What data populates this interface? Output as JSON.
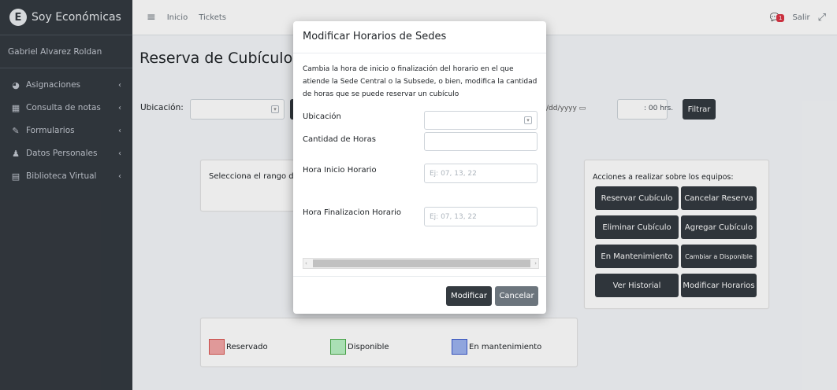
{
  "brand": {
    "name": "Soy Económicas",
    "logo_letter": "E"
  },
  "user": {
    "name": "Gabriel Alvarez Roldan"
  },
  "sidebar": {
    "items": [
      {
        "label": "Asignaciones",
        "icon": "dashboard-icon",
        "glyph": "◕"
      },
      {
        "label": "Consulta de notas",
        "icon": "table-icon",
        "glyph": "▦"
      },
      {
        "label": "Formularios",
        "icon": "edit-icon",
        "glyph": "✎"
      },
      {
        "label": "Datos Personales",
        "icon": "user-icon",
        "glyph": "♟"
      },
      {
        "label": "Biblioteca Virtual",
        "icon": "book-icon",
        "glyph": "▤"
      }
    ]
  },
  "topbar": {
    "links": [
      "Inicio",
      "Tickets"
    ],
    "notification_count": "1",
    "logout": "Salir"
  },
  "page": {
    "title": "Reserva de Cubículos",
    "location_label": "Ubicación:",
    "date_placeholder": "/dd/yyyy",
    "hours_suffix": ": 00 hrs.",
    "filter_button": "Filtrar",
    "date_range_text": "Selecciona el rango de fe"
  },
  "actions": {
    "title": "Acciones a realizar sobre los equipos:",
    "buttons": [
      "Reservar Cubículo",
      "Cancelar Reserva",
      "Eliminar Cubículo",
      "Agregar Cubículo",
      "En Mantenimiento",
      "Cambiar a Disponible",
      "Ver Historial",
      "Modificar Horarios"
    ]
  },
  "legend": [
    {
      "label": "Reservado",
      "color": "#f4a6a6",
      "border": "#d9534f"
    },
    {
      "label": "Disponible",
      "color": "#b9f2c4",
      "border": "#4cae4c"
    },
    {
      "label": "En mantenimiento",
      "color": "#9db4f0",
      "border": "#3b5bcc"
    }
  ],
  "modal": {
    "title": "Modificar Horarios de Sedes",
    "description": "Cambia la hora de inicio o finalización del horario en el que atiende la Sede Central o la Subsede, o bien, modifica la cantidad de horas que se puede reservar un cubículo",
    "location_label": "Ubicación",
    "hours_label": "Cantidad de Horas",
    "start_label": "Hora Inicio Horario",
    "start_placeholder": "Ej: 07, 13, 22",
    "end_label": "Hora Finalizacion Horario",
    "end_placeholder": "Ej: 07, 13, 22",
    "modify_button": "Modificar",
    "cancel_button": "Cancelar"
  }
}
